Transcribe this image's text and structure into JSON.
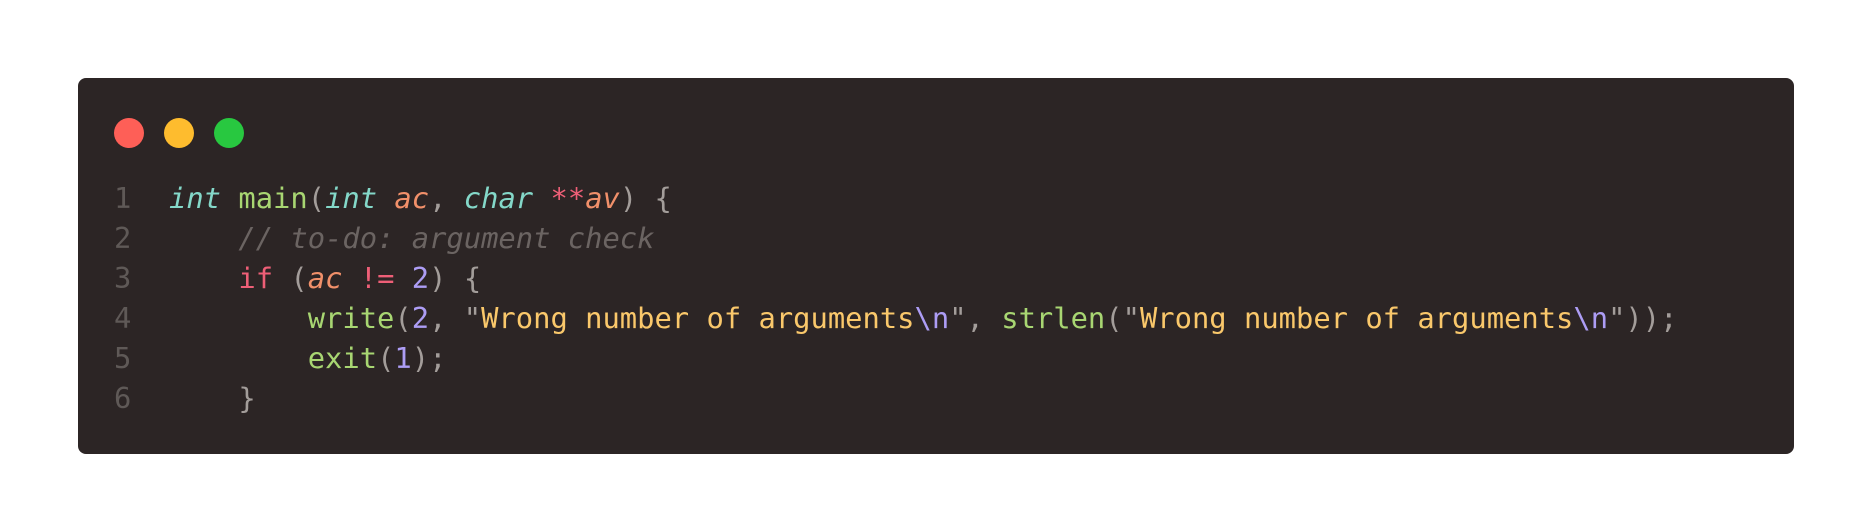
{
  "window": {
    "controls": [
      {
        "name": "close",
        "color": "#fe5f57"
      },
      {
        "name": "minimize",
        "color": "#febc2e"
      },
      {
        "name": "maximize",
        "color": "#28c840"
      }
    ]
  },
  "code": {
    "language": "c",
    "lines": [
      {
        "number": "1",
        "tokens": [
          {
            "text": "int",
            "type": "kw-italic"
          },
          {
            "text": " ",
            "type": "punc"
          },
          {
            "text": "main",
            "type": "fn"
          },
          {
            "text": "(",
            "type": "punc"
          },
          {
            "text": "int",
            "type": "kw-italic"
          },
          {
            "text": " ",
            "type": "punc"
          },
          {
            "text": "ac",
            "type": "param"
          },
          {
            "text": ", ",
            "type": "punc"
          },
          {
            "text": "char",
            "type": "kw-italic"
          },
          {
            "text": " ",
            "type": "punc"
          },
          {
            "text": "**",
            "type": "op"
          },
          {
            "text": "av",
            "type": "param"
          },
          {
            "text": ") {",
            "type": "punc"
          }
        ]
      },
      {
        "number": "2",
        "tokens": [
          {
            "text": "    ",
            "type": "punc"
          },
          {
            "text": "// to-do: argument check",
            "type": "comment"
          }
        ]
      },
      {
        "number": "3",
        "tokens": [
          {
            "text": "    ",
            "type": "punc"
          },
          {
            "text": "if",
            "type": "ctrl"
          },
          {
            "text": " (",
            "type": "punc"
          },
          {
            "text": "ac",
            "type": "param"
          },
          {
            "text": " ",
            "type": "punc"
          },
          {
            "text": "!=",
            "type": "op"
          },
          {
            "text": " ",
            "type": "punc"
          },
          {
            "text": "2",
            "type": "num"
          },
          {
            "text": ") {",
            "type": "punc"
          }
        ]
      },
      {
        "number": "4",
        "tokens": [
          {
            "text": "        ",
            "type": "punc"
          },
          {
            "text": "write",
            "type": "fn"
          },
          {
            "text": "(",
            "type": "punc"
          },
          {
            "text": "2",
            "type": "num"
          },
          {
            "text": ", \"",
            "type": "punc"
          },
          {
            "text": "Wrong number of arguments",
            "type": "str"
          },
          {
            "text": "\\n",
            "type": "esc"
          },
          {
            "text": "\", ",
            "type": "punc"
          },
          {
            "text": "strlen",
            "type": "fn"
          },
          {
            "text": "(\"",
            "type": "punc"
          },
          {
            "text": "Wrong number of arguments",
            "type": "str"
          },
          {
            "text": "\\n",
            "type": "esc"
          },
          {
            "text": "\"));",
            "type": "punc"
          }
        ]
      },
      {
        "number": "5",
        "tokens": [
          {
            "text": "        ",
            "type": "punc"
          },
          {
            "text": "exit",
            "type": "fn"
          },
          {
            "text": "(",
            "type": "punc"
          },
          {
            "text": "1",
            "type": "num"
          },
          {
            "text": ");",
            "type": "punc"
          }
        ]
      },
      {
        "number": "6",
        "tokens": [
          {
            "text": "    }",
            "type": "punc"
          }
        ]
      }
    ]
  }
}
